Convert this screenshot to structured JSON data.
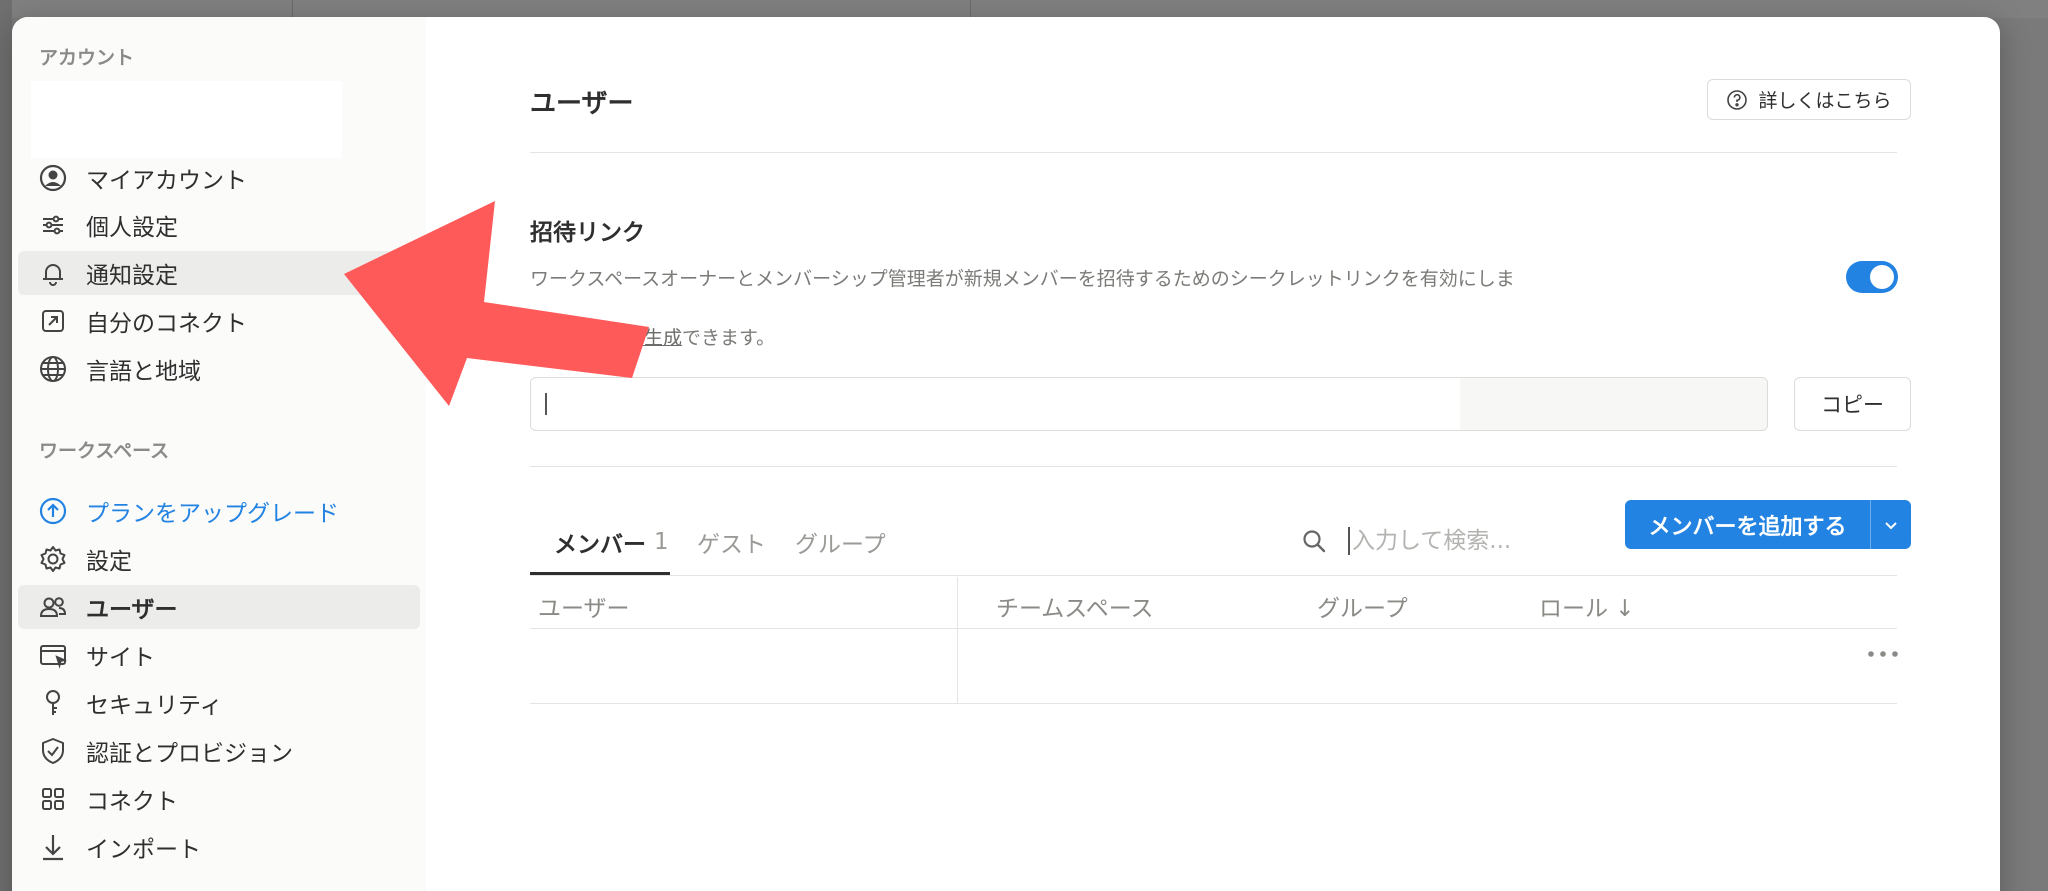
{
  "sidebar": {
    "account_label": "アカウント",
    "account_items": [
      {
        "label": "マイアカウント",
        "icon": "user-circle-icon"
      },
      {
        "label": "個人設定",
        "icon": "sliders-icon"
      },
      {
        "label": "通知設定",
        "icon": "bell-icon"
      },
      {
        "label": "自分のコネクト",
        "icon": "external-link-icon"
      },
      {
        "label": "言語と地域",
        "icon": "globe-icon"
      }
    ],
    "workspace_label": "ワークスペース",
    "workspace_items": [
      {
        "label": "プランをアップグレード",
        "icon": "upgrade-arrow-icon"
      },
      {
        "label": "設定",
        "icon": "gear-icon"
      },
      {
        "label": "ユーザー",
        "icon": "users-icon"
      },
      {
        "label": "サイト",
        "icon": "browser-window-icon"
      },
      {
        "label": "セキュリティ",
        "icon": "key-icon"
      },
      {
        "label": "認証とプロビジョン",
        "icon": "shield-check-icon"
      },
      {
        "label": "コネクト",
        "icon": "grid-icon"
      },
      {
        "label": "インポート",
        "icon": "download-arrow-icon"
      }
    ]
  },
  "main": {
    "title": "ユーザー",
    "learn_more_label": "詳しくはこちら",
    "invite": {
      "heading": "招待リンク",
      "description": "ワークスペースオーナーとメンバーシップ管理者が新規メンバーを招待するためのシークレットリンクを有効にしま",
      "description2_prefix": "",
      "description2_link": "しいリンクを生成",
      "description2_suffix": "できます。",
      "enabled": true,
      "copy_label": "コピー"
    },
    "tabs": [
      {
        "label": "メンバー",
        "count": "1"
      },
      {
        "label": "ゲスト"
      },
      {
        "label": "グループ"
      }
    ],
    "search_placeholder": "入力して検索...",
    "add_member_label": "メンバーを追加する",
    "table_headers": [
      "ユーザー",
      "チームスペース",
      "グループ",
      "ロール ↓"
    ]
  },
  "colors": {
    "accent": "#2383e2",
    "annotation_arrow": "#ff5a5a"
  }
}
